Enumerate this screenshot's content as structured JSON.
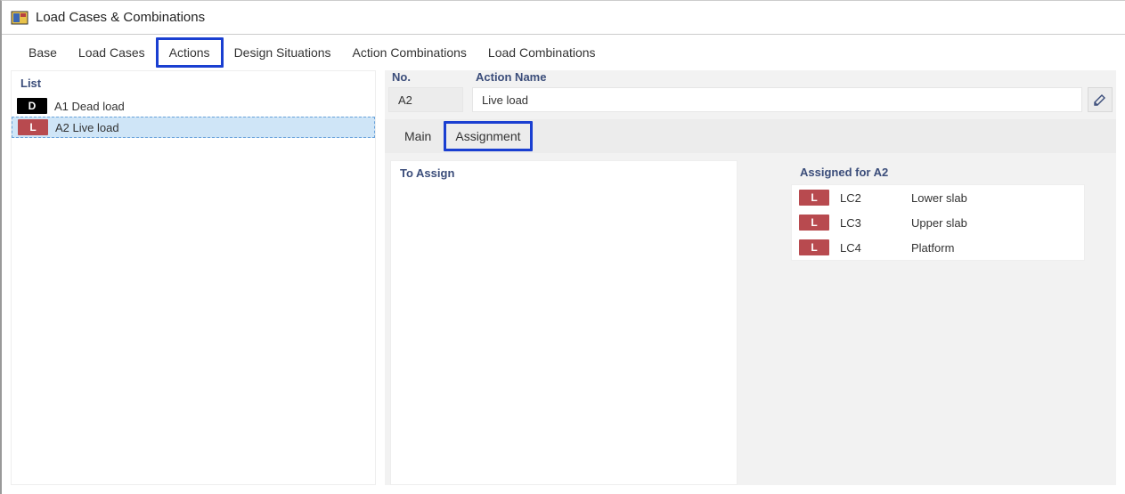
{
  "window": {
    "title": "Load Cases & Combinations"
  },
  "tabs": {
    "base": "Base",
    "loadCases": "Load Cases",
    "actions": "Actions",
    "designSituations": "Design Situations",
    "actionCombinations": "Action Combinations",
    "loadCombinations": "Load Combinations"
  },
  "leftPanel": {
    "header": "List",
    "items": [
      {
        "badge": "D",
        "badgeClass": "dark",
        "label": "A1 Dead load"
      },
      {
        "badge": "L",
        "badgeClass": "red",
        "label": "A2 Live load"
      }
    ]
  },
  "form": {
    "noLabel": "No.",
    "noValue": "A2",
    "nameLabel": "Action Name",
    "nameValue": "Live load"
  },
  "subtabs": {
    "main": "Main",
    "assignment": "Assignment"
  },
  "toAssign": {
    "header": "To Assign"
  },
  "assigned": {
    "header": "Assigned for A2",
    "items": [
      {
        "badge": "L",
        "code": "LC2",
        "name": "Lower slab"
      },
      {
        "badge": "L",
        "code": "LC3",
        "name": "Upper slab"
      },
      {
        "badge": "L",
        "code": "LC4",
        "name": "Platform"
      }
    ]
  }
}
